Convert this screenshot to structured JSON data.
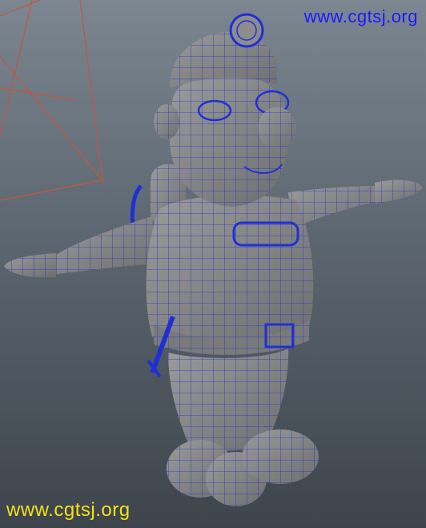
{
  "watermark": {
    "top_text": "www.cgtsj.org",
    "top_color": "#1a1aff",
    "bottom_text": "www.cgtsj.org",
    "bottom_color": "#f3e21a"
  },
  "viewport": {
    "background_top": "#7b8691",
    "background_bottom": "#3d444b",
    "camera_frustum_color": "#c8553a",
    "wireframe_color": "#1f2fd6",
    "mesh_fill": "#8c8c8c"
  }
}
